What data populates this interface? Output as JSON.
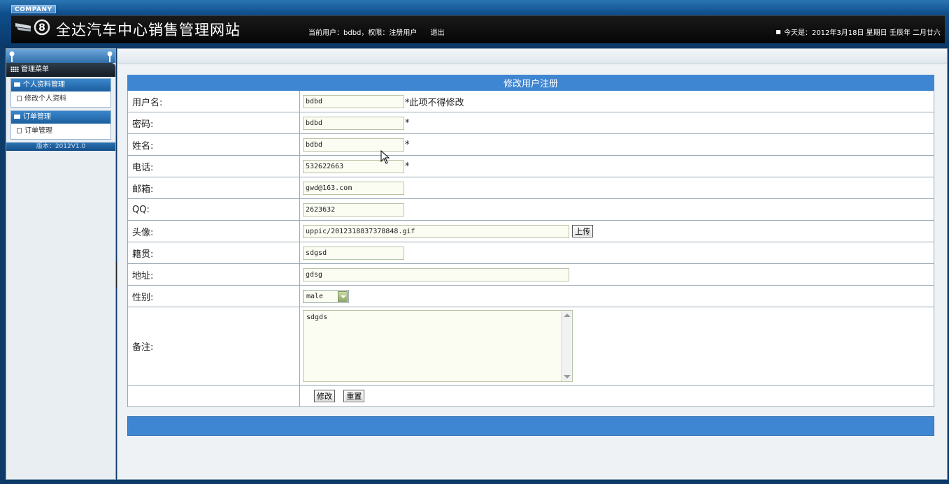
{
  "header": {
    "company": "COMPANY",
    "site_title": "全达汽车中心销售管理网站",
    "user_info": "当前用户：bdbd，权限：注册用户",
    "logout": "退出",
    "today": "今天是：2012年3月18日 星期日 壬辰年 二月廿六"
  },
  "sidebar": {
    "menu_title": "管理菜单",
    "groups": [
      {
        "title": "个人资料管理",
        "items": [
          "修改个人资料"
        ]
      },
      {
        "title": "订单管理",
        "items": [
          "订单管理"
        ]
      }
    ],
    "version": "版本：2012V1.0"
  },
  "form": {
    "title": "修改用户注册",
    "username": {
      "label": "用户名:",
      "value": "bdbd",
      "note": "*此项不得修改"
    },
    "password": {
      "label": "密码:",
      "value": "bdbd",
      "note": "*"
    },
    "name": {
      "label": "姓名:",
      "value": "bdbd",
      "note": "*"
    },
    "phone": {
      "label": "电话:",
      "value": "532622663",
      "note": "*"
    },
    "email": {
      "label": "邮箱:",
      "value": "gwd@163.com"
    },
    "qq": {
      "label": "QQ:",
      "value": "2623632"
    },
    "avatar": {
      "label": "头像:",
      "value": "uppic/2012318837378848.gif",
      "button": "上传"
    },
    "hometown": {
      "label": "籍贯:",
      "value": "sdgsd"
    },
    "address": {
      "label": "地址:",
      "value": "gdsg"
    },
    "gender": {
      "label": "性别:",
      "value": "male"
    },
    "remark": {
      "label": "备注:",
      "value": "sdgds"
    },
    "submit": "修改",
    "reset": "重置"
  },
  "colors": {
    "accent": "#3f86d2",
    "header_dark": "#0a3a6c"
  }
}
